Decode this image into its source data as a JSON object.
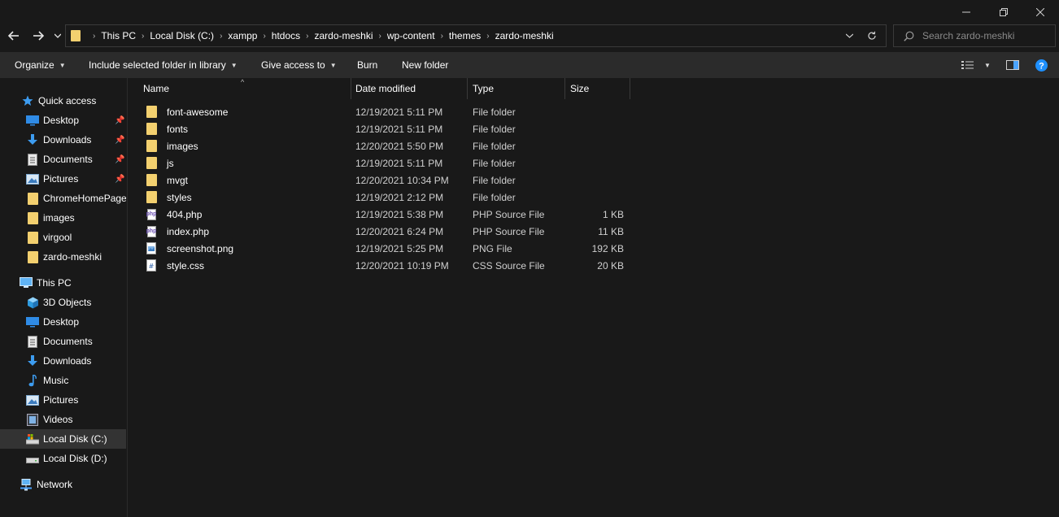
{
  "window": {
    "minimize_glyph": "—",
    "restore_glyph": "❐",
    "close_glyph": "✕"
  },
  "address": {
    "crumbs": [
      "This PC",
      "Local Disk (C:)",
      "xampp",
      "htdocs",
      "zardo-meshki",
      "wp-content",
      "themes",
      "zardo-meshki"
    ]
  },
  "search": {
    "placeholder": "Search zardo-meshki"
  },
  "toolbar": {
    "organize": "Organize",
    "include": "Include selected folder in library",
    "give_access": "Give access to",
    "burn": "Burn",
    "new_folder": "New folder"
  },
  "nav": {
    "quick_access": "Quick access",
    "quick_items": [
      "Desktop",
      "Downloads",
      "Documents",
      "Pictures",
      "ChromeHomePage",
      "images",
      "virgool",
      "zardo-meshki"
    ],
    "this_pc": "This PC",
    "pc_items": [
      "3D Objects",
      "Desktop",
      "Documents",
      "Downloads",
      "Music",
      "Pictures",
      "Videos",
      "Local Disk (C:)",
      "Local Disk (D:)"
    ],
    "network": "Network",
    "selected": "Local Disk (C:)"
  },
  "columns": {
    "name": "Name",
    "date": "Date modified",
    "type": "Type",
    "size": "Size"
  },
  "files": [
    {
      "name": "font-awesome",
      "date": "12/19/2021 5:11 PM",
      "type": "File folder",
      "size": "",
      "icon": "folder-icon"
    },
    {
      "name": "fonts",
      "date": "12/19/2021 5:11 PM",
      "type": "File folder",
      "size": "",
      "icon": "folder-icon"
    },
    {
      "name": "images",
      "date": "12/20/2021 5:50 PM",
      "type": "File folder",
      "size": "",
      "icon": "folder-icon"
    },
    {
      "name": "js",
      "date": "12/19/2021 5:11 PM",
      "type": "File folder",
      "size": "",
      "icon": "folder-icon"
    },
    {
      "name": "mvgt",
      "date": "12/20/2021 10:34 PM",
      "type": "File folder",
      "size": "",
      "icon": "folder-icon"
    },
    {
      "name": "styles",
      "date": "12/19/2021 2:12 PM",
      "type": "File folder",
      "size": "",
      "icon": "folder-icon"
    },
    {
      "name": "404.php",
      "date": "12/19/2021 5:38 PM",
      "type": "PHP Source File",
      "size": "1 KB",
      "icon": "php-file-icon"
    },
    {
      "name": "index.php",
      "date": "12/20/2021 6:24 PM",
      "type": "PHP Source File",
      "size": "11 KB",
      "icon": "php-file-icon"
    },
    {
      "name": "screenshot.png",
      "date": "12/19/2021 5:25 PM",
      "type": "PNG File",
      "size": "192 KB",
      "icon": "image-file-icon"
    },
    {
      "name": "style.css",
      "date": "12/20/2021 10:19 PM",
      "type": "CSS Source File",
      "size": "20 KB",
      "icon": "css-file-icon"
    }
  ],
  "colors": {
    "background": "#191919",
    "toolbar": "#2b2b2b",
    "folder": "#f3d06f",
    "accent": "#1e90ff"
  }
}
